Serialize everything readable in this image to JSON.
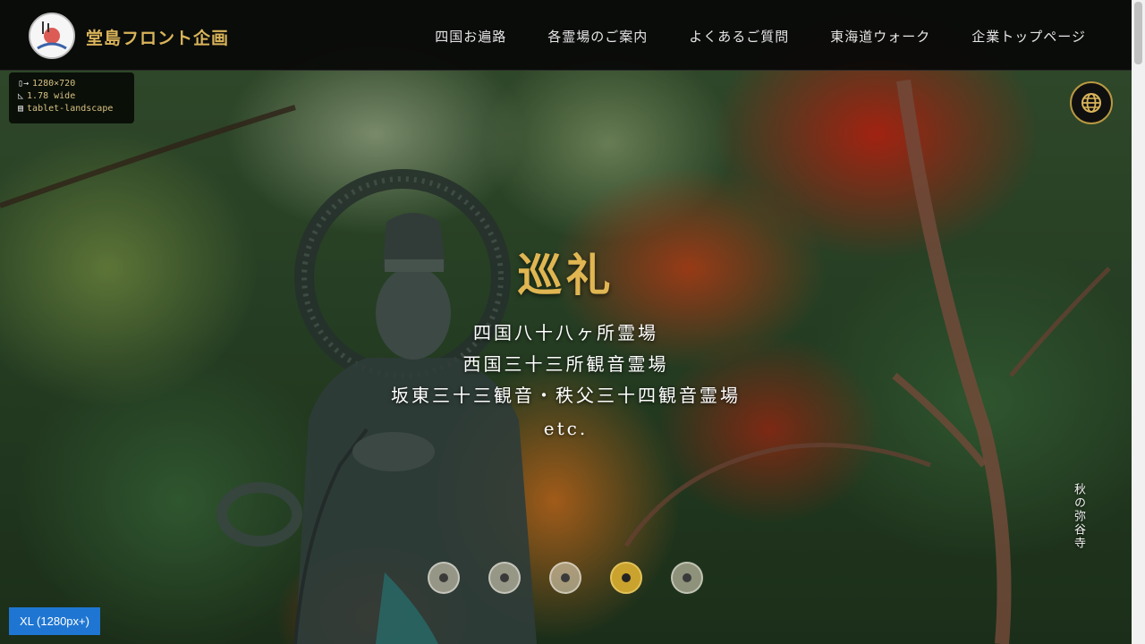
{
  "header": {
    "brand": "堂島フロント企画",
    "nav": [
      "四国お遍路",
      "各霊場のご案内",
      "よくあるご質問",
      "東海道ウォーク",
      "企業トップページ"
    ]
  },
  "device_info": {
    "resolution": "1280×720",
    "aspect": "1.78 wide",
    "mode": "tablet-landscape"
  },
  "hero": {
    "title": "巡礼",
    "lines": [
      "四国八十八ヶ所霊場",
      "西国三十三所観音霊場",
      "坂東三十三観音・秩父三十四観音霊場",
      "etc."
    ],
    "caption": "秋の弥谷寺"
  },
  "slider": {
    "count": 5,
    "active_index": 3
  },
  "breakpoint_badge": "XL (1280px+)",
  "colors": {
    "accent_gold": "#d9b45a",
    "badge_blue": "#1f76d2",
    "header_bg": "#080808"
  }
}
